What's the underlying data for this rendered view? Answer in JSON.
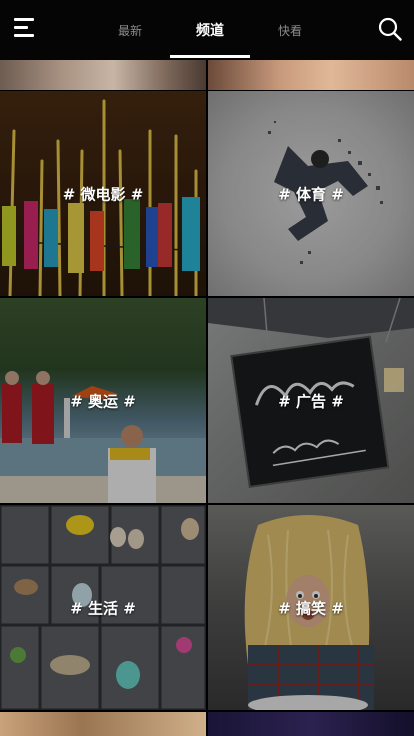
{
  "header": {
    "menu_icon": "hamburger-menu-icon",
    "tabs": [
      {
        "label": "最新",
        "active": false
      },
      {
        "label": "频道",
        "active": true
      },
      {
        "label": "快看",
        "active": false
      }
    ],
    "search_icon": "search-icon"
  },
  "channels": [
    {
      "label": "# 微电影 #"
    },
    {
      "label": "# 体育 #"
    },
    {
      "label": "# 奥运 #"
    },
    {
      "label": "# 广告 #"
    },
    {
      "label": "# 生活 #"
    },
    {
      "label": "# 搞笑 #"
    }
  ],
  "colors": {
    "background": "#000000",
    "active_tab": "#ffffff",
    "inactive_tab": "#8c8c8c",
    "indicator": "#ffffff"
  }
}
